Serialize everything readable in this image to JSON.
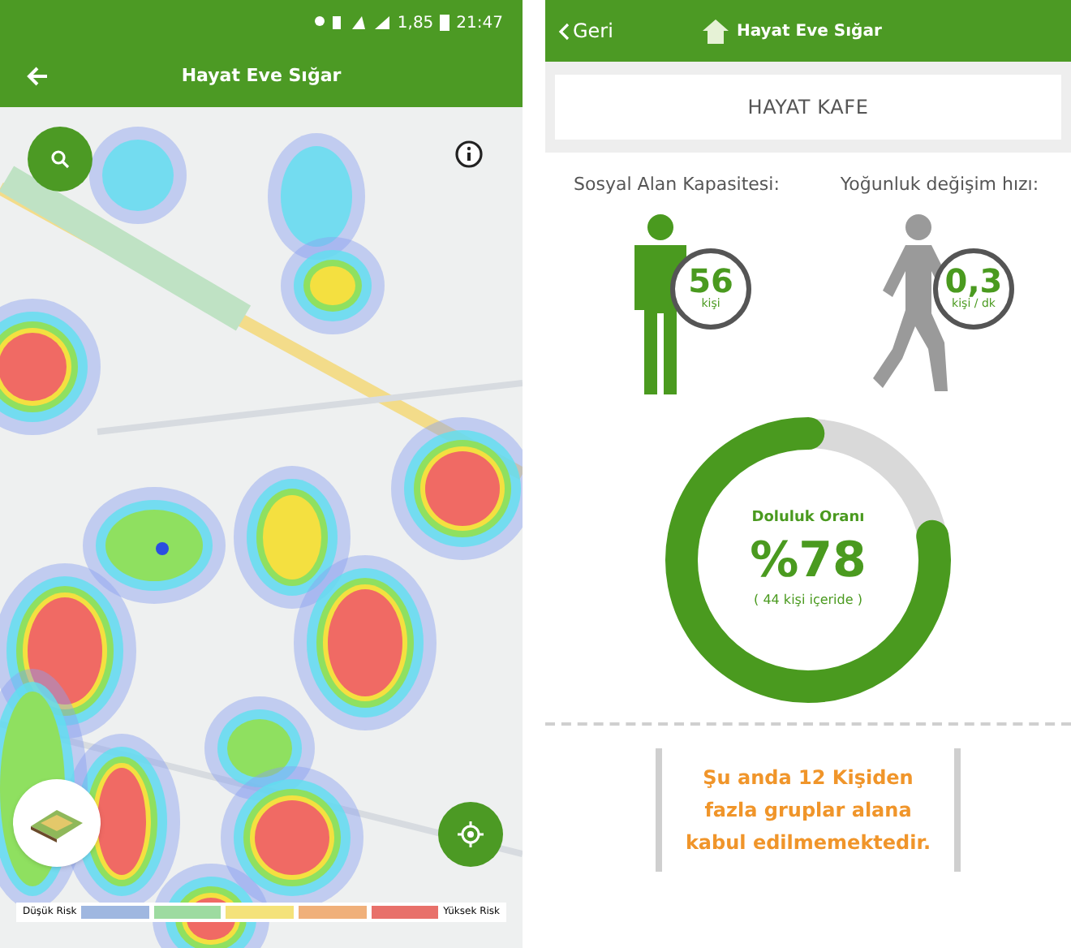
{
  "status_bar": {
    "battery_text": "1,85",
    "time": "21:47"
  },
  "map_screen": {
    "title": "Hayat Eve Sığar",
    "legend": {
      "low_label": "Düşük Risk",
      "high_label": "Yüksek Risk",
      "segments": [
        {
          "color": "#9fb7e0"
        },
        {
          "color": "#9ddba0"
        },
        {
          "color": "#f4e27a"
        },
        {
          "color": "#f0b07a"
        },
        {
          "color": "#e8706a"
        }
      ]
    }
  },
  "venue_screen": {
    "back_label": "Geri",
    "title": "Hayat Eve Sığar",
    "venue_name": "HAYAT KAFE",
    "stats": [
      {
        "kind": "capacity",
        "label": "Sosyal Alan Kapasitesi:",
        "value": "56",
        "unit": "kişi"
      },
      {
        "kind": "rate",
        "label": "Yoğunluk değişim hızı:",
        "value": "0,3",
        "unit": "kişi / dk"
      }
    ],
    "occupancy": {
      "label": "Doluluk Oranı",
      "value": "%78",
      "detail": "( 44 kişi içeride )",
      "level": 0.78
    },
    "notice": "Şu anda 12 Kişiden fazla gruplar alana kabul edilmemektedir."
  }
}
